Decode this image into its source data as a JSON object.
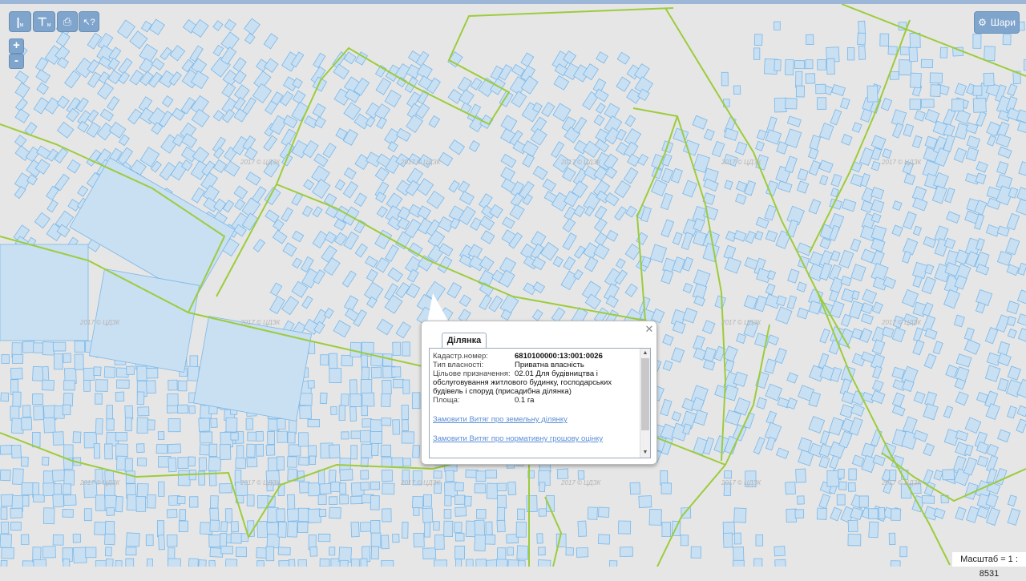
{
  "toolbar": {
    "ruler_label": "м",
    "area_label": "м",
    "zoom_in": "+",
    "zoom_out": "-"
  },
  "layers": {
    "label": "Шари"
  },
  "scale": {
    "label": "Масштаб = 1 : 8531"
  },
  "watermark": "2017 © ЦДЗК",
  "popup": {
    "tab": "Ділянка",
    "fields": [
      {
        "label": "Кадастр.номер:",
        "value": "6810100000:13:001:0026"
      },
      {
        "label": "Тип власності:",
        "value": "Приватна власність"
      },
      {
        "label": "Цільове призначення:",
        "value": "02.01 Для будівництва і"
      }
    ],
    "purpose_cont": [
      "обслуговування житлового будинку, господарських",
      "будівель і споруд (присадибна ділянка)"
    ],
    "area": {
      "label": "Площа:",
      "value": "0.1 га"
    },
    "links": [
      "Замовити Витяг про земельну ділянку",
      "Замовити Витяг про нормативну грошову оцінку"
    ]
  },
  "colors": {
    "map_bg": "#e6e6e6",
    "parcel_fill": "#c9dff2",
    "parcel_stroke": "#7ab8e8",
    "boundary": "#9ccc3c",
    "button": "#7fa5cc"
  }
}
